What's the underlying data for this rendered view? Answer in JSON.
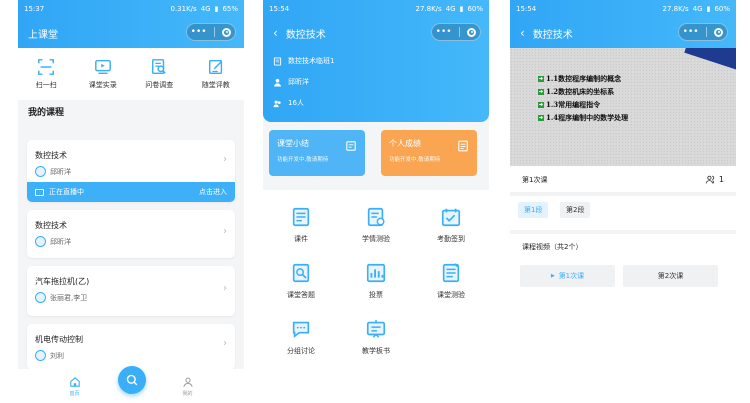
{
  "screens": {
    "s1": {
      "status": {
        "time": "15:37",
        "speed": "0.31K/s",
        "battery": "65%",
        "network": "4G"
      },
      "title": "上课堂",
      "quick": [
        {
          "label": "扫一扫",
          "icon": "scan-icon"
        },
        {
          "label": "课堂实录",
          "icon": "video-icon"
        },
        {
          "label": "问卷调查",
          "icon": "survey-icon"
        },
        {
          "label": "随堂评教",
          "icon": "evaluate-icon"
        }
      ],
      "section_title": "我的课程",
      "courses": [
        {
          "name": "数控技术",
          "teacher": "邱昕洋"
        },
        {
          "name": "数控技术",
          "teacher": "邱昕洋"
        },
        {
          "name": "汽车拖拉机(乙)",
          "teacher": "张丽君,李卫"
        },
        {
          "name": "机电传动控制",
          "teacher": "刘利"
        }
      ],
      "live": {
        "status": "正在直播中",
        "action": "点击进入"
      },
      "tabs": [
        {
          "label": "首页"
        },
        {
          "label": "我的"
        }
      ]
    },
    "s2": {
      "status": {
        "time": "15:54",
        "speed": "27.8K/s",
        "battery": "60%",
        "network": "4G"
      },
      "title": "数控技术",
      "info": [
        {
          "text": "数控技术临班1",
          "icon": "class-icon"
        },
        {
          "text": "邱昕洋",
          "icon": "teacher-icon"
        },
        {
          "text": "16人",
          "icon": "people-icon"
        }
      ],
      "tiles": [
        {
          "title": "课堂小结",
          "sub": "功能开发中,敬请期待"
        },
        {
          "title": "个人成绩",
          "sub": "功能开发中,敬请期待"
        }
      ],
      "grid": [
        {
          "label": "课件",
          "icon": "courseware-icon"
        },
        {
          "label": "学情测验",
          "icon": "quiz-icon"
        },
        {
          "label": "考勤签到",
          "icon": "attendance-icon"
        },
        {
          "label": "课堂答题",
          "icon": "answer-icon"
        },
        {
          "label": "投票",
          "icon": "vote-icon"
        },
        {
          "label": "课堂测验",
          "icon": "test-icon"
        },
        {
          "label": "分组讨论",
          "icon": "discussion-icon"
        },
        {
          "label": "教学板书",
          "icon": "board-icon"
        }
      ]
    },
    "s3": {
      "status": {
        "time": "15:54",
        "speed": "27.8K/s",
        "battery": "60%",
        "network": "4G"
      },
      "title": "数控技术",
      "slide_lines": [
        "1.1数控程序编制的概念",
        "1.2数控机床的坐标系",
        "1.3常用编程指令",
        "1.4程序编制中的数学处理"
      ],
      "lesson": {
        "label": "第1次课",
        "count": "1"
      },
      "segments": [
        {
          "label": "第1段"
        },
        {
          "label": "第2段"
        }
      ],
      "videos_title": "课程视频（共2个）",
      "video_buttons": [
        {
          "label": "第1次课"
        },
        {
          "label": "第2次课"
        }
      ]
    }
  },
  "colors": {
    "primary": "#3aaef7",
    "tile_blue": "#4fb5f7",
    "tile_orange": "#f9a552"
  }
}
